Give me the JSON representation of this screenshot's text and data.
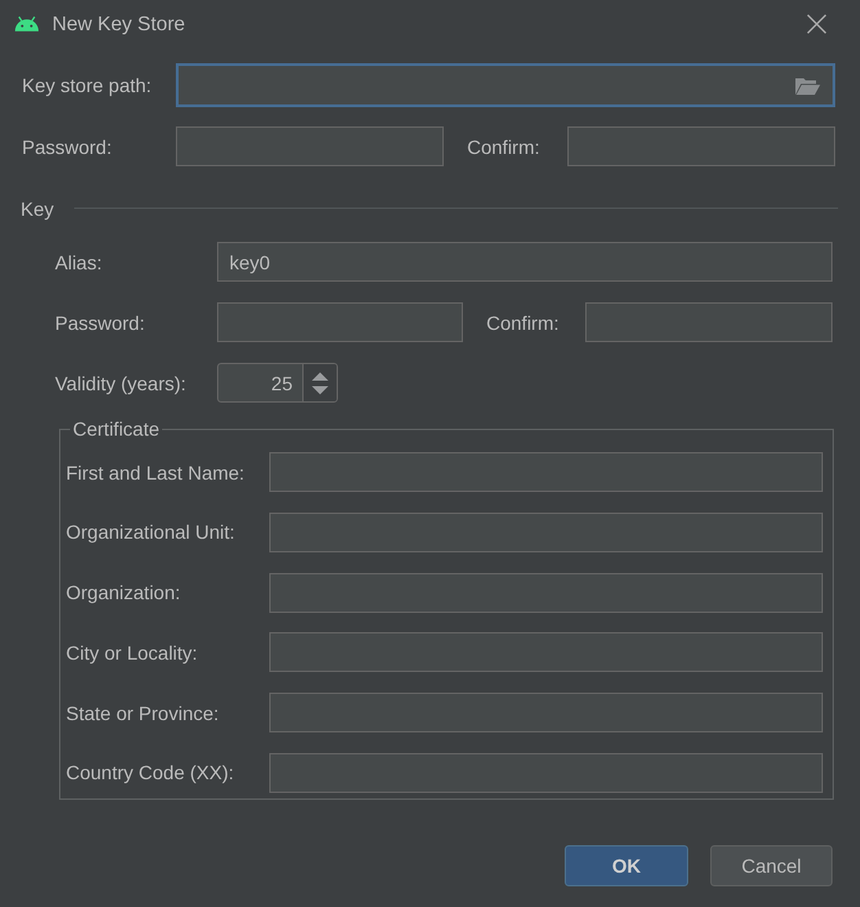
{
  "window": {
    "title": "New Key Store"
  },
  "key_store": {
    "path": {
      "label": "Key store path:",
      "focused": true
    },
    "password": {
      "label": "Password:"
    },
    "confirm": {
      "label": "Confirm:"
    }
  },
  "key": {
    "title": "Key",
    "alias": {
      "label": "Alias:",
      "value": "key0"
    },
    "password": {
      "label": "Password:"
    },
    "confirm": {
      "label": "Confirm:"
    },
    "validity": {
      "label": "Validity (years):",
      "value": "25"
    }
  },
  "certificate": {
    "title": "Certificate",
    "fields": [
      {
        "label": "First and Last Name:"
      },
      {
        "label": "Organizational Unit:"
      },
      {
        "label": "Organization:"
      },
      {
        "label": "City or Locality:"
      },
      {
        "label": "State or Province:"
      },
      {
        "label": "Country Code (XX):"
      }
    ]
  },
  "buttons": [
    {
      "label": "OK",
      "kind": "default"
    },
    {
      "label": "Cancel",
      "kind": "plain"
    }
  ]
}
